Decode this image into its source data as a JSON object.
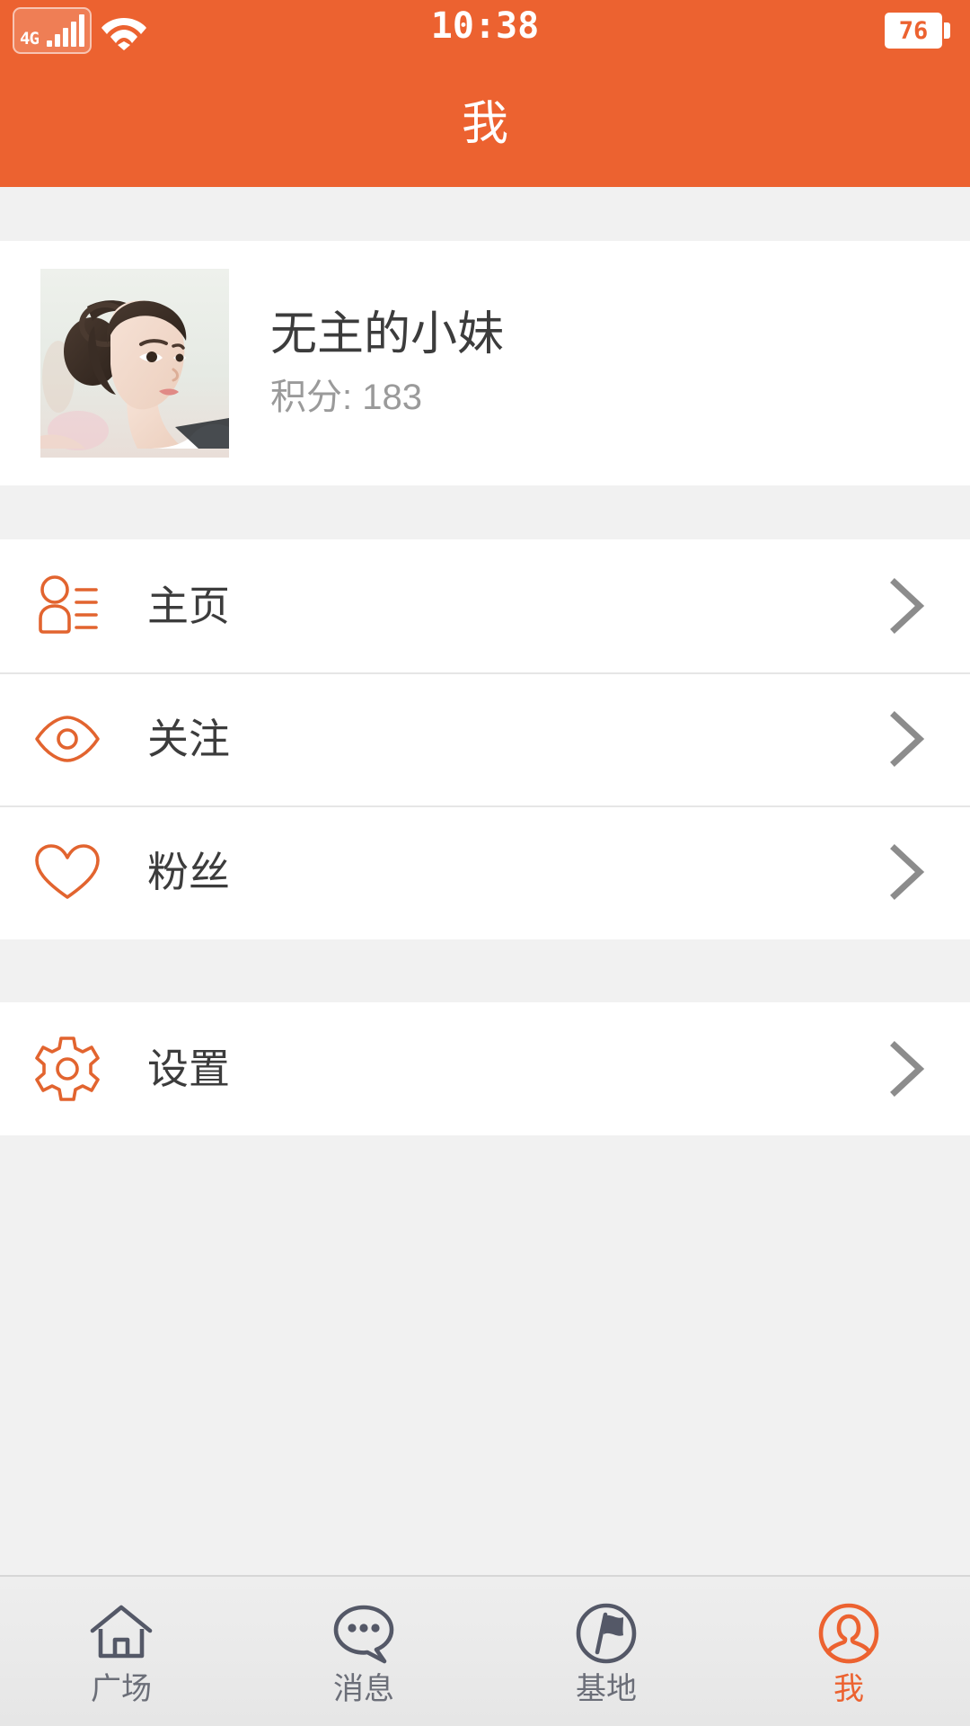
{
  "theme": {
    "accent": "#ec6230",
    "header_bg": "#ec6230",
    "page_bg": "#f1f1f1",
    "card_bg": "#ffffff",
    "text_primary": "#3c3c3c",
    "text_muted": "#9a9a9a",
    "chevron": "#8c8c8c",
    "tab_inactive": "#6b6e78"
  },
  "statusbar": {
    "network_label": "4G",
    "network_icon": "signal-bars-icon",
    "wifi_icon": "wifi-icon",
    "time": "10:38",
    "battery_level": "76",
    "battery_icon": "battery-icon"
  },
  "header": {
    "title": "我"
  },
  "profile": {
    "avatar_icon": "user-avatar-photo",
    "name": "无主的小妹",
    "points_label": "积分: 183"
  },
  "menu_groups": [
    {
      "id": "group-profile",
      "items": [
        {
          "id": "homepage",
          "label": "主页",
          "icon": "user-list-icon"
        },
        {
          "id": "following",
          "label": "关注",
          "icon": "eye-icon"
        },
        {
          "id": "fans",
          "label": "粉丝",
          "icon": "heart-icon"
        }
      ]
    },
    {
      "id": "group-settings",
      "items": [
        {
          "id": "settings",
          "label": "设置",
          "icon": "gear-icon"
        }
      ]
    }
  ],
  "chevron_icon": "chevron-right-icon",
  "tabbar": {
    "tabs": [
      {
        "id": "plaza",
        "label": "广场",
        "icon": "home-icon",
        "active": false
      },
      {
        "id": "messages",
        "label": "消息",
        "icon": "chat-bubble-icon",
        "active": false
      },
      {
        "id": "base",
        "label": "基地",
        "icon": "flag-circle-icon",
        "active": false
      },
      {
        "id": "me",
        "label": "我",
        "icon": "user-circle-icon",
        "active": true
      }
    ]
  }
}
